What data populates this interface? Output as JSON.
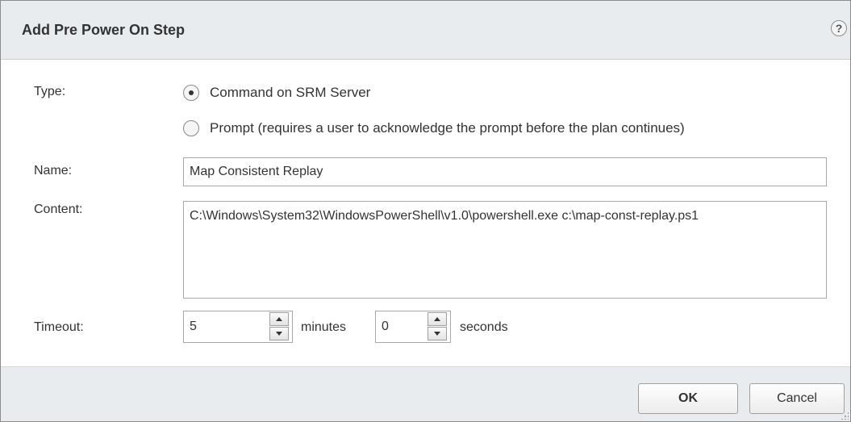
{
  "dialog": {
    "title": "Add Pre Power On Step",
    "help_label": "?"
  },
  "form": {
    "type": {
      "label": "Type:",
      "options": [
        {
          "label": "Command on SRM Server",
          "selected": true
        },
        {
          "label": "Prompt (requires a user to acknowledge the prompt before the plan continues)",
          "selected": false
        }
      ]
    },
    "name": {
      "label": "Name:",
      "value": "Map Consistent Replay"
    },
    "content": {
      "label": "Content:",
      "value": "C:\\Windows\\System32\\WindowsPowerShell\\v1.0\\powershell.exe c:\\map-const-replay.ps1"
    },
    "timeout": {
      "label": "Timeout:",
      "minutes_value": "5",
      "minutes_unit": "minutes",
      "seconds_value": "0",
      "seconds_unit": "seconds"
    }
  },
  "footer": {
    "ok_label": "OK",
    "cancel_label": "Cancel"
  },
  "colors": {
    "header_bg": "#e9ecef",
    "footer_bg": "#e9ecef",
    "text": "#333333",
    "border": "#a9a9a9"
  }
}
